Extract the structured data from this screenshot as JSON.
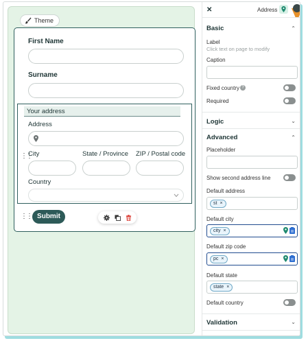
{
  "canvas": {
    "theme_label": "Theme",
    "form": {
      "first_name_label": "First Name",
      "surname_label": "Surname",
      "address_header": "Your address",
      "address_label": "Address",
      "city_label": "City",
      "state_label": "State / Province",
      "zip_label": "ZIP / Postal code",
      "country_label": "Country",
      "submit_label": "Submit"
    }
  },
  "panel": {
    "close_label": "✕",
    "title": "Address",
    "sections": {
      "basic": "Basic",
      "logic": "Logic",
      "advanced": "Advanced",
      "validation": "Validation"
    },
    "basic": {
      "label_title": "Label",
      "label_hint": "Click text on page to modify",
      "caption_title": "Caption",
      "fixed_country_label": "Fixed country",
      "required_label": "Required"
    },
    "advanced": {
      "placeholder_label": "Placeholder",
      "show_second_line_label": "Show second address line",
      "default_address_label": "Default address",
      "default_address_tag": "st",
      "default_city_label": "Default city",
      "default_city_tag": "city",
      "default_zip_label": "Default zip code",
      "default_zip_tag": "pc",
      "default_state_label": "Default state",
      "default_state_tag": "state",
      "default_country_label": "Default country"
    },
    "tag_remove": "×"
  },
  "colors": {
    "primary": "#2d5a58",
    "canvas_bg": "#e4f3e6",
    "accent_orange": "#e8912a",
    "active_field_border": "#1f4b8e",
    "delete_icon": "#d9342b"
  }
}
